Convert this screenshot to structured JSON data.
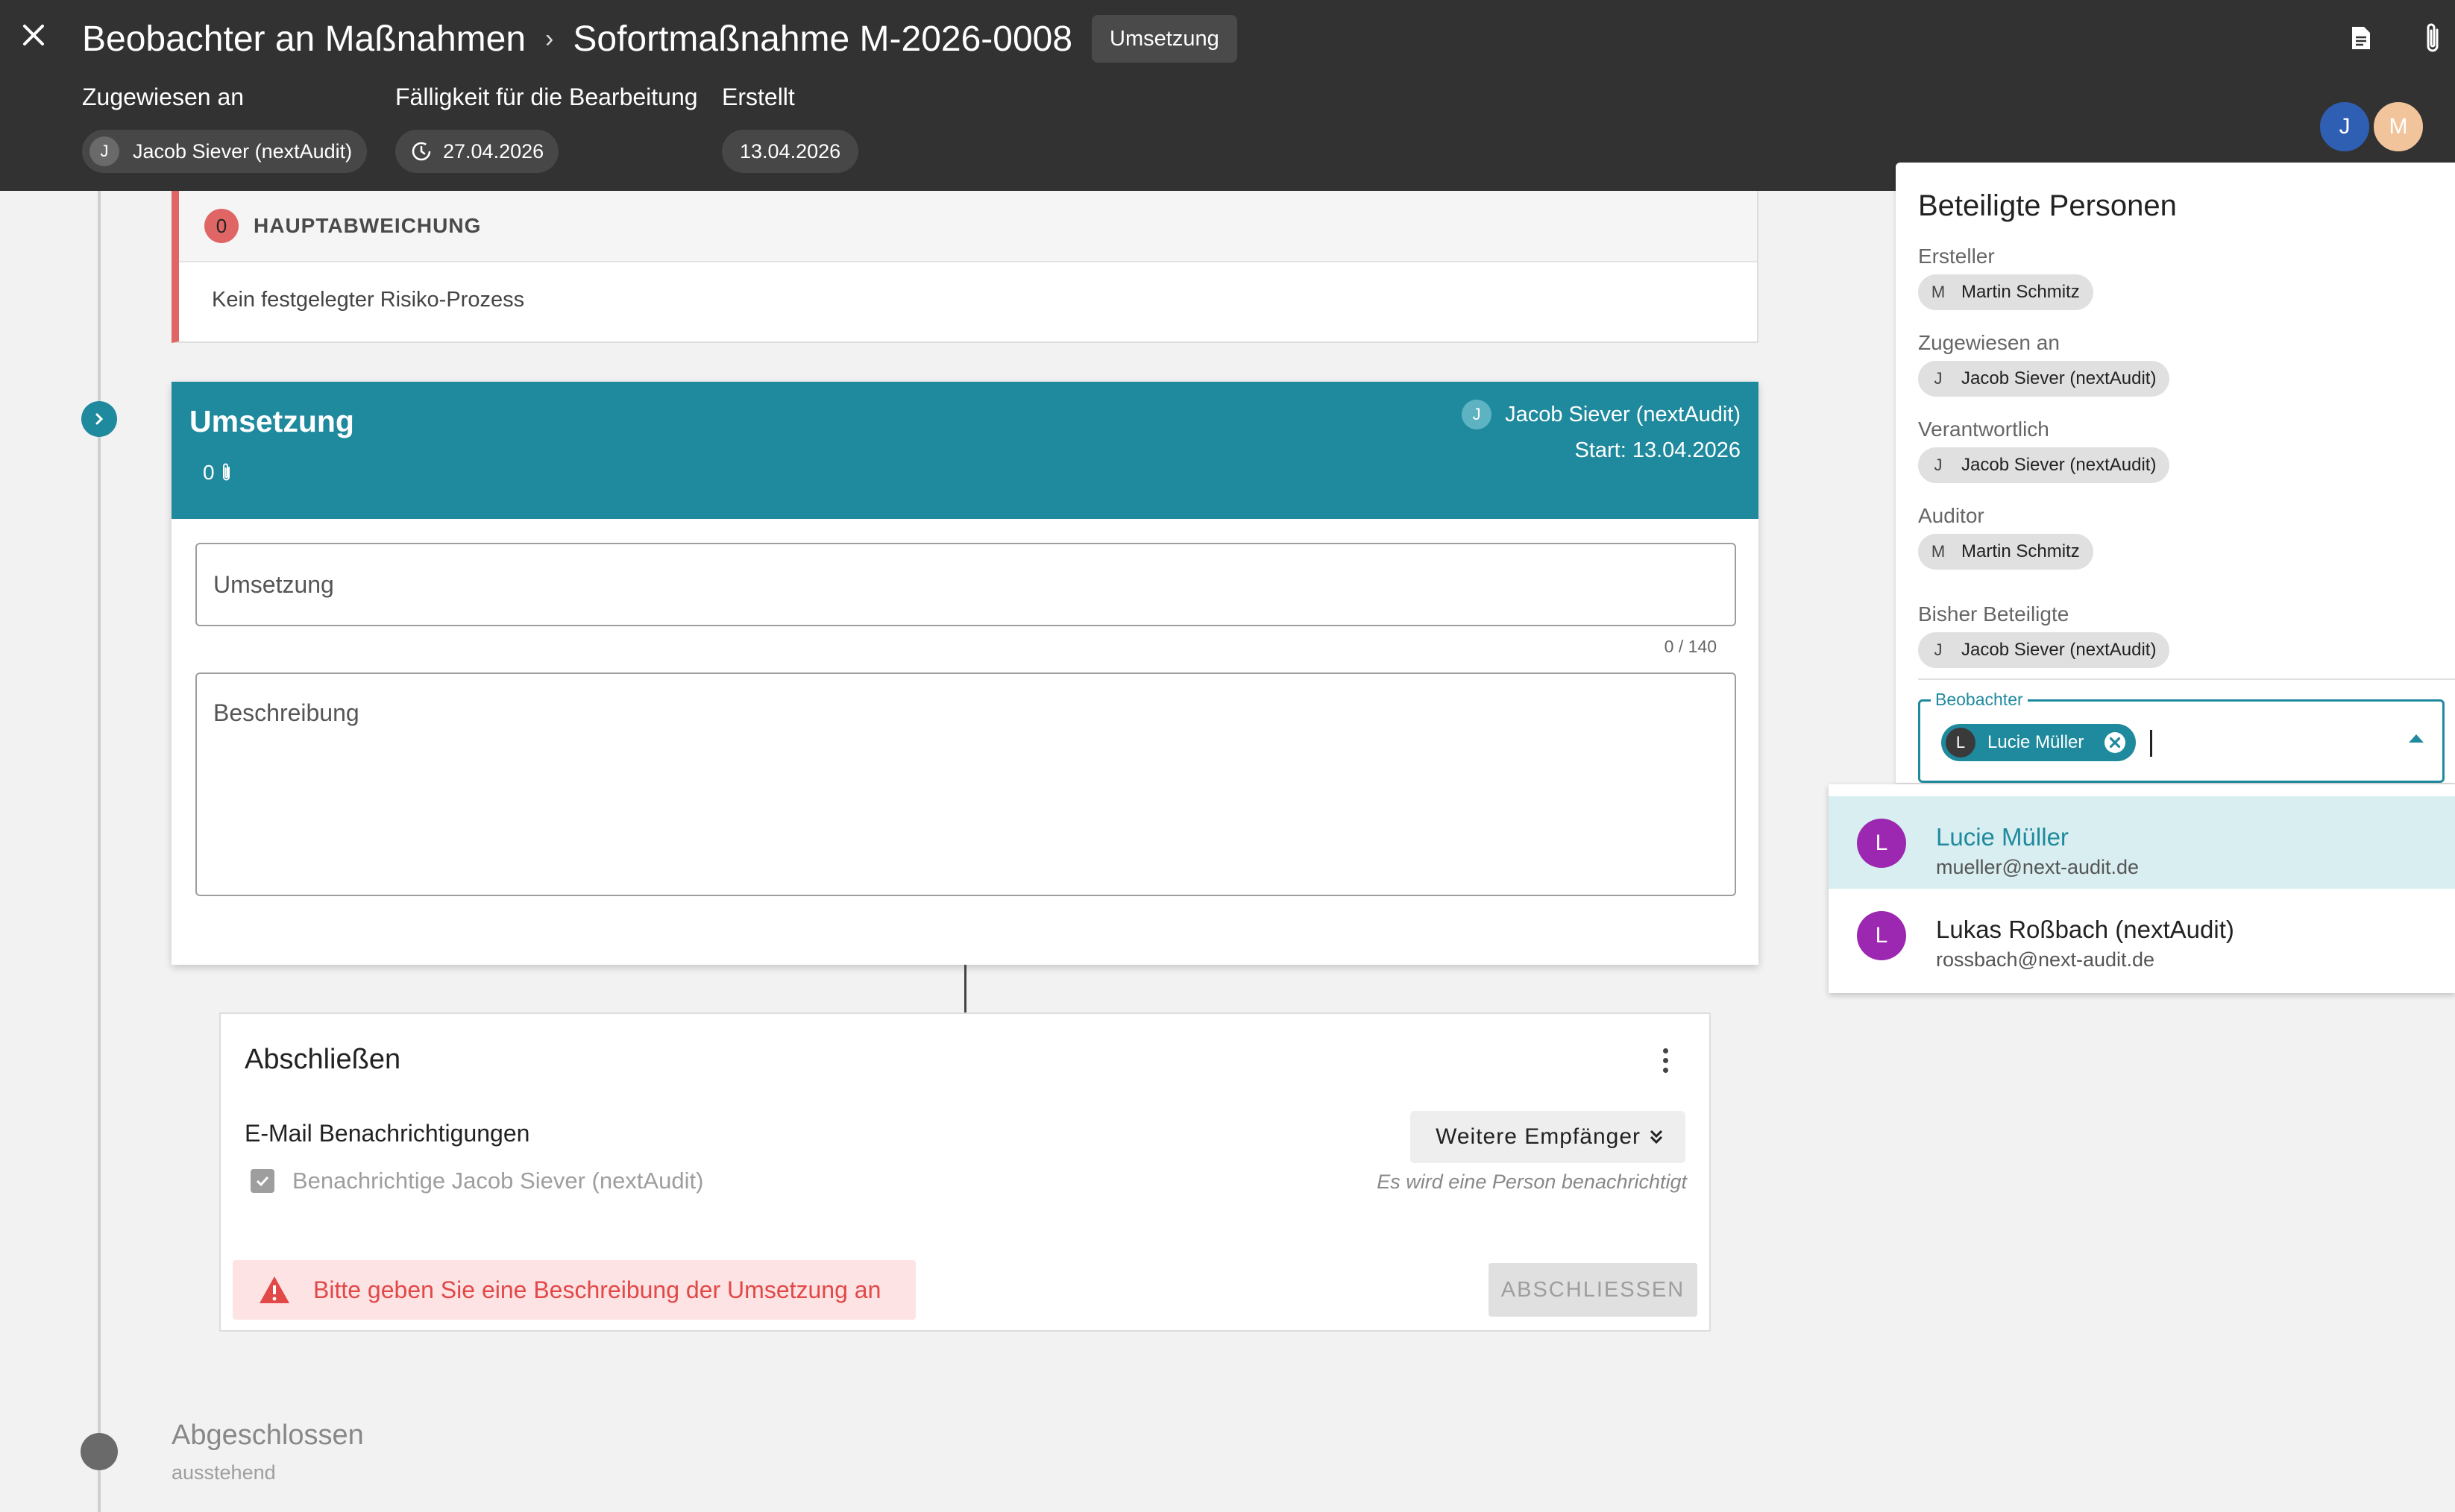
{
  "header": {
    "breadcrumb_parent": "Beobachter an Maßnahmen",
    "breadcrumb_separator": "›",
    "title": "Sofortmaßnahme M-2026-0008",
    "status_chip": "Umsetzung",
    "assigned": {
      "label": "Zugewiesen an",
      "initial": "J",
      "value": "Jacob Siever (nextAudit)"
    },
    "due": {
      "label": "Fälligkeit für die Bearbeitung",
      "value": "27.04.2026"
    },
    "created": {
      "label": "Erstellt",
      "value": "13.04.2026"
    },
    "avatars": [
      {
        "initial": "J",
        "color": "#2f5fb3"
      },
      {
        "initial": "M",
        "color": "#f2c49b"
      }
    ]
  },
  "deviation": {
    "count": "0",
    "title": "HAUPTABWEICHUNG",
    "text": "Kein festgelegter Risiko-Prozess"
  },
  "umsetzung": {
    "title": "Umsetzung",
    "attachments": "0",
    "assignee_initial": "J",
    "assignee": "Jacob Siever (nextAudit)",
    "start": "Start: 13.04.2026",
    "field_placeholder": "Umsetzung",
    "counter": "0 / 140",
    "description_placeholder": "Beschreibung"
  },
  "abschluss": {
    "title": "Abschließen",
    "email_heading": "E-Mail Benachrichtigungen",
    "notify_label": "Benachrichtige Jacob Siever (nextAudit)",
    "more_recipients": "Weitere Empfänger",
    "note": "Es wird eine Person benachrichtigt",
    "error": "Bitte geben Sie eine Beschreibung der Umsetzung an",
    "submit": "ABSCHLIESSEN"
  },
  "closed": {
    "title": "Abgeschlossen",
    "subtitle": "ausstehend"
  },
  "panel": {
    "title": "Beteiligte Personen",
    "groups": [
      {
        "label": "Ersteller",
        "initial": "M",
        "name": "Martin Schmitz"
      },
      {
        "label": "Zugewiesen an",
        "initial": "J",
        "name": "Jacob Siever (nextAudit)"
      },
      {
        "label": "Verantwortlich",
        "initial": "J",
        "name": "Jacob Siever (nextAudit)"
      },
      {
        "label": "Auditor",
        "initial": "M",
        "name": "Martin Schmitz"
      },
      {
        "label": "Bisher Beteiligte",
        "initial": "J",
        "name": "Jacob Siever (nextAudit)"
      }
    ],
    "observer": {
      "label": "Beobachter",
      "chip_initial": "L",
      "chip_name": "Lucie Müller"
    }
  },
  "dropdown": {
    "options": [
      {
        "initial": "L",
        "name": "Lucie Müller",
        "email": "mueller@next-audit.de",
        "selected": true
      },
      {
        "initial": "L",
        "name": "Lukas Roßbach (nextAudit)",
        "email": "rossbach@next-audit.de",
        "selected": false
      }
    ]
  },
  "colors": {
    "header_bg": "#323232",
    "accent": "#1f8a9e",
    "error": "#e24848",
    "deviation": "#e06666",
    "option_avatar": "#9c27b0"
  }
}
